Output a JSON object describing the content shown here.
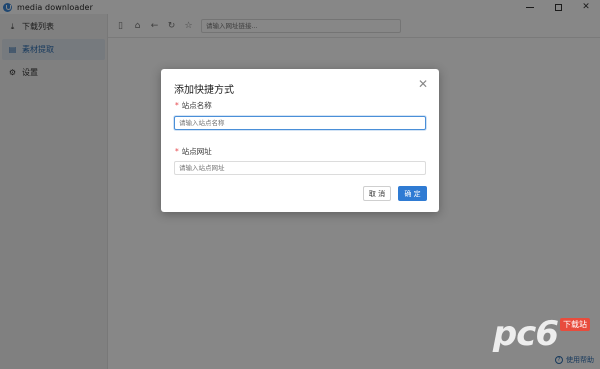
{
  "window": {
    "title": "media downloader",
    "controls": {
      "minimize": "",
      "maximize": "",
      "close": "✕"
    }
  },
  "sidebar": {
    "items": [
      {
        "label": "下载列表",
        "icon": "download-icon",
        "active": false
      },
      {
        "label": "素材提取",
        "icon": "document-icon",
        "active": true
      },
      {
        "label": "设置",
        "icon": "gear-icon",
        "active": false
      }
    ]
  },
  "toolbar": {
    "url_placeholder": "请输入网址链接..."
  },
  "content": {
    "help_label": "使用帮助"
  },
  "dialog": {
    "title": "添加快捷方式",
    "close": "✕",
    "fields": [
      {
        "label": "站点名称",
        "required": true,
        "placeholder": "请输入站点名称",
        "value": ""
      },
      {
        "label": "站点网址",
        "required": true,
        "placeholder": "请输入站点网址",
        "value": ""
      }
    ],
    "cancel_label": "取 消",
    "ok_label": "确 定"
  },
  "watermark": {
    "logo": "pc6",
    "tag": "下载站"
  },
  "colors": {
    "accent": "#2f7bd3",
    "required": "#e5484d",
    "overlay": "rgba(0,0,0,0.47)"
  }
}
